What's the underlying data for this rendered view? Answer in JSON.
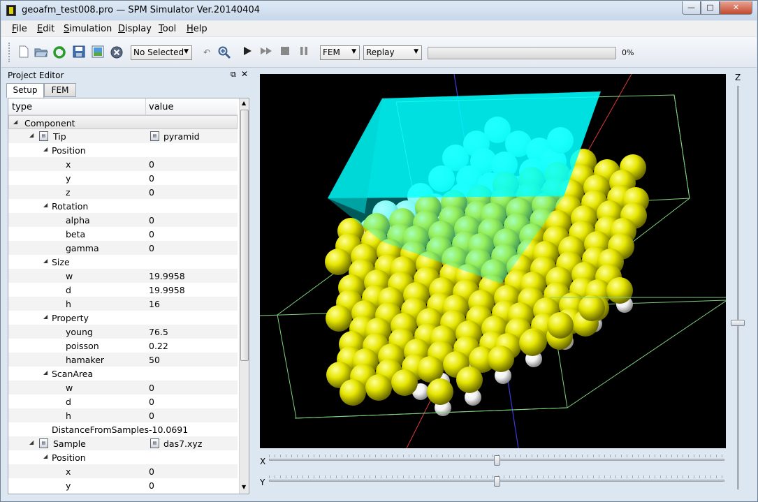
{
  "window": {
    "title": "geoafm_test008.pro — SPM Simulator Ver.20140404",
    "min_label": "—",
    "max_label": "□",
    "close_label": "✕"
  },
  "menu": [
    {
      "label": "File",
      "key": "F"
    },
    {
      "label": "Edit",
      "key": "E"
    },
    {
      "label": "Simulation",
      "key": "S"
    },
    {
      "label": "Display",
      "key": "D"
    },
    {
      "label": "Tool",
      "key": "T"
    },
    {
      "label": "Help",
      "key": "H"
    }
  ],
  "toolbar": {
    "icons": [
      "new-file-icon",
      "open-folder-icon",
      "reload-icon",
      "save-icon",
      "image-icon",
      "stop-circle-icon",
      "undo-icon",
      "zoom-icon",
      "play-icon",
      "fast-forward-icon",
      "stop-icon",
      "pause-icon"
    ],
    "selection_combo": "No Selected",
    "mode_combo": "FEM",
    "replay_combo": "Replay",
    "progress_value": 0,
    "progress_text": "0%"
  },
  "project_editor": {
    "title": "Project Editor",
    "tabs": [
      "Setup",
      "FEM"
    ],
    "active_tab": "Setup",
    "columns": {
      "type": "type",
      "value": "value"
    },
    "rows": [
      {
        "label": "Component",
        "value": "",
        "level": 0,
        "expandable": true,
        "kind": "group"
      },
      {
        "label": "Tip",
        "value": "pyramid",
        "level": 1,
        "expandable": true,
        "kind": "file"
      },
      {
        "label": "Position",
        "value": "",
        "level": 2,
        "expandable": true
      },
      {
        "label": "x",
        "value": "0",
        "level": 3
      },
      {
        "label": "y",
        "value": "0",
        "level": 3
      },
      {
        "label": "z",
        "value": "0",
        "level": 3
      },
      {
        "label": "Rotation",
        "value": "",
        "level": 2,
        "expandable": true
      },
      {
        "label": "alpha",
        "value": "0",
        "level": 3
      },
      {
        "label": "beta",
        "value": "0",
        "level": 3
      },
      {
        "label": "gamma",
        "value": "0",
        "level": 3
      },
      {
        "label": "Size",
        "value": "",
        "level": 2,
        "expandable": true
      },
      {
        "label": "w",
        "value": "19.9958",
        "level": 3
      },
      {
        "label": "d",
        "value": "19.9958",
        "level": 3
      },
      {
        "label": "h",
        "value": "16",
        "level": 3
      },
      {
        "label": "Property",
        "value": "",
        "level": 2,
        "expandable": true
      },
      {
        "label": "young",
        "value": "76.5",
        "level": 3
      },
      {
        "label": "poisson",
        "value": "0.22",
        "level": 3
      },
      {
        "label": "hamaker",
        "value": "50",
        "level": 3
      },
      {
        "label": "ScanArea",
        "value": "",
        "level": 2,
        "expandable": true
      },
      {
        "label": "w",
        "value": "0",
        "level": 3
      },
      {
        "label": "d",
        "value": "0",
        "level": 3
      },
      {
        "label": "h",
        "value": "0",
        "level": 3
      },
      {
        "label": "DistanceFromSamples",
        "value": "-10.0691",
        "level": 2
      },
      {
        "label": "Sample",
        "value": "das7.xyz",
        "level": 1,
        "expandable": true,
        "kind": "file"
      },
      {
        "label": "Position",
        "value": "",
        "level": 2,
        "expandable": true
      },
      {
        "label": "x",
        "value": "0",
        "level": 3
      },
      {
        "label": "y",
        "value": "0",
        "level": 3
      }
    ]
  },
  "viewer": {
    "z_label": "Z",
    "x_label": "X",
    "y_label": "Y",
    "z_slider": 0.58,
    "x_slider": 0.5,
    "y_slider": 0.5,
    "colors": {
      "background": "#000000",
      "tip": "#00ffff",
      "sample_atoms": "#e6e600",
      "bottom_atoms": "#f2f2f2",
      "bounding_box": "#7fd17f",
      "axis_x": "#e03a3a",
      "axis_y": "#3a3ae0"
    }
  }
}
